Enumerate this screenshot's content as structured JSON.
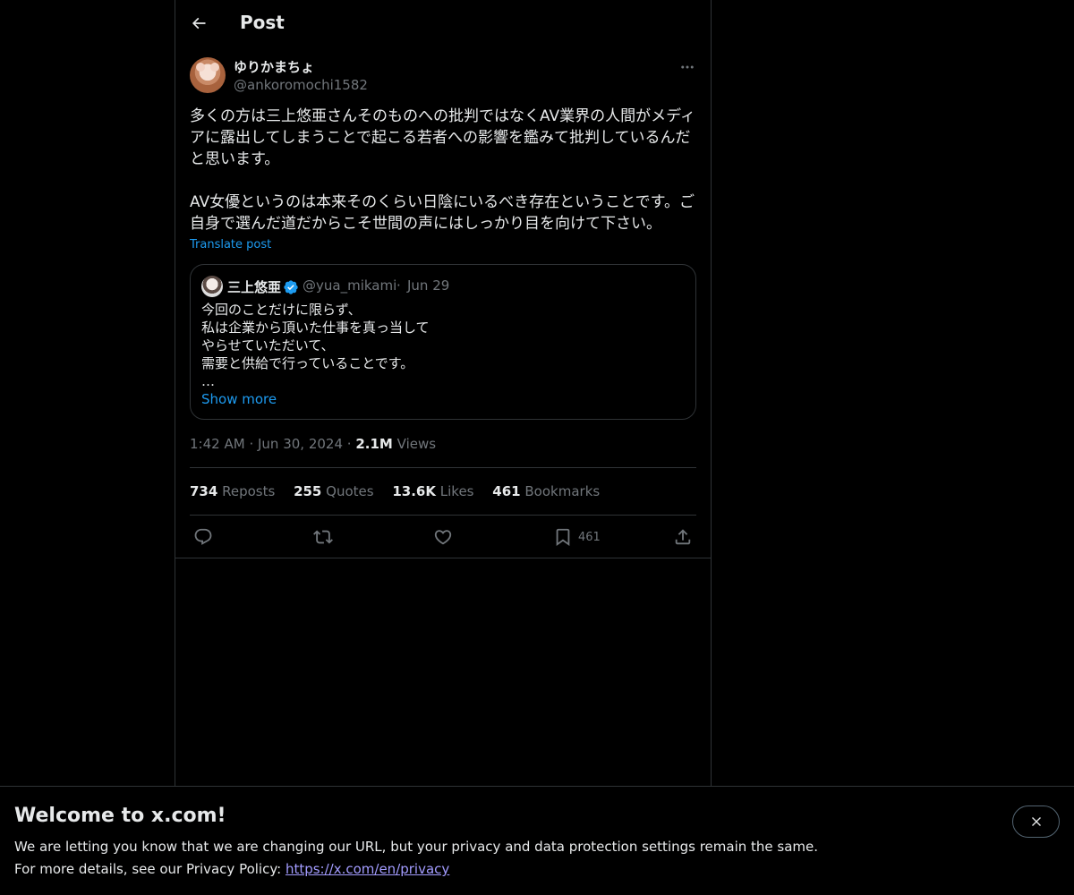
{
  "header": {
    "title": "Post"
  },
  "post": {
    "display_name": "ゆりかまちょ",
    "handle": "@ankoromochi1582",
    "text": "多くの方は三上悠亜さんそのものへの批判ではなくAV業界の人間がメディアに露出してしまうことで起こる若者への影響を鑑みて批判しているんだと思います。\n\nAV女優というのは本来そのくらい日陰にいるべき存在ということです。ご自身で選んだ道だからこそ世間の声にはしっかり目を向けて下さい。",
    "translate_label": "Translate post",
    "time": "1:42 AM",
    "date": "Jun 30, 2024",
    "views_count": "2.1M",
    "views_label": "Views",
    "separator": "·"
  },
  "quote": {
    "display_name": "三上悠亜",
    "handle": "@yua_mikami",
    "separator": "·",
    "date": "Jun 29",
    "text": "今回のことだけに限らず、\n私は企業から頂いた仕事を真っ当して\nやらせていただいて、\n需要と供給で行っていることです。\n…",
    "show_more": "Show more"
  },
  "stats": {
    "reposts": {
      "count": "734",
      "label": "Reposts"
    },
    "quotes": {
      "count": "255",
      "label": "Quotes"
    },
    "likes": {
      "count": "13.6K",
      "label": "Likes"
    },
    "bookmarks": {
      "count": "461",
      "label": "Bookmarks"
    }
  },
  "actions": {
    "reply_icon": "reply-icon",
    "repost_icon": "repost-icon",
    "like_icon": "heart-icon",
    "bookmark_icon": "bookmark-icon",
    "bookmark_count": "461",
    "share_icon": "share-icon"
  },
  "banner": {
    "title": "Welcome to x.com!",
    "line1": "We are letting you know that we are changing our URL, but your privacy and data protection settings remain the same.",
    "line2_prefix": "For more details, see our Privacy Policy: ",
    "link": "https://x.com/en/privacy"
  },
  "colors": {
    "background": "#000000",
    "text": "#e7e9ea",
    "muted": "#71767b",
    "accent": "#1d9bf0",
    "border": "#2f3336",
    "link_visited": "#a29bfe"
  }
}
